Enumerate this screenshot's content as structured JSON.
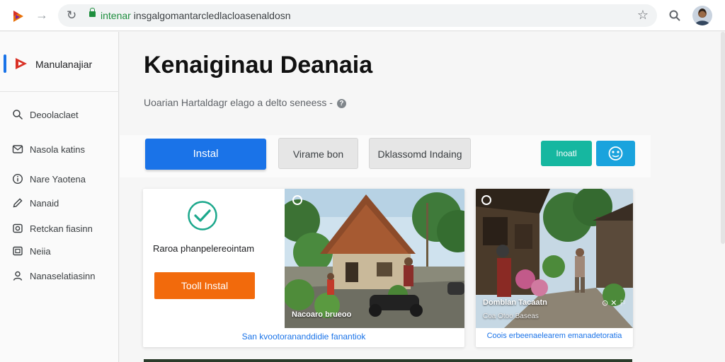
{
  "browser": {
    "url_scheme": "intenar",
    "url_rest": " insgalgomantarcledlacloasenaldosn",
    "colors": {
      "secure": "#1e8e3e",
      "accent": "#1a73e8"
    }
  },
  "sidebar": {
    "brand": "Manulanajiar",
    "items": [
      {
        "label": "Deoolaclaet",
        "icon": "search-icon"
      },
      {
        "label": "Nasola katins",
        "icon": "mail-icon"
      },
      {
        "label": "Nare Yaotena",
        "icon": "info-icon"
      },
      {
        "label": "Nanaid",
        "icon": "edit-icon"
      },
      {
        "label": "Retckan fiasinn",
        "icon": "camera-icon"
      },
      {
        "label": "Neiia",
        "icon": "media-icon"
      },
      {
        "label": "Nanaselatiasinn",
        "icon": "user-icon"
      }
    ]
  },
  "main": {
    "title": "Kenaiginau Deanaia",
    "subtitle": "Uoarian Hartaldagr elago a delto seneess -",
    "actions": {
      "primary": "Instal",
      "secondary1": "Virame bon",
      "secondary2": "Dklassomd Indaing",
      "teal": "Inoatl"
    },
    "card1": {
      "label": "Raroa phanpelereointam",
      "button": "Tooll Instal",
      "photo_caption": "Nacoaro brueoo",
      "link": "San kvootorananddidie fanantiok"
    },
    "card2": {
      "caption_title": "Domblan Tacaatn",
      "caption_sub": "Coa Otoo Baseas",
      "link": "Coois erbeenaelearem emanadetoratia"
    }
  }
}
